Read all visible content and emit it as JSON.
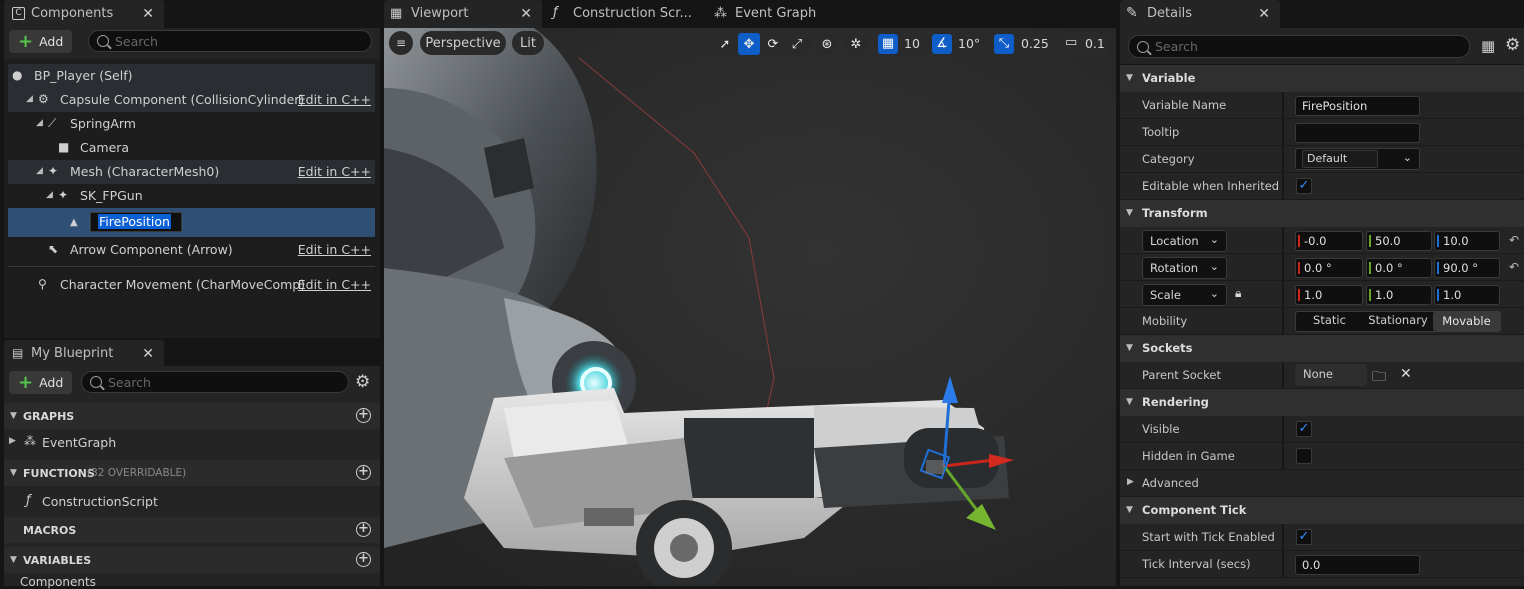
{
  "components_panel": {
    "tab_label": "Components",
    "add_label": "Add",
    "search_placeholder": "Search",
    "tree": [
      {
        "label": "BP_Player (Self)",
        "edit": ""
      },
      {
        "label": "Capsule Component (CollisionCylinder)",
        "edit": "Edit in C++"
      },
      {
        "label": "SpringArm",
        "edit": ""
      },
      {
        "label": "Camera",
        "edit": ""
      },
      {
        "label": "Mesh (CharacterMesh0)",
        "edit": "Edit in C++"
      },
      {
        "label": "SK_FPGun",
        "edit": ""
      },
      {
        "label": "FirePosition",
        "edit": ""
      },
      {
        "label": "Arrow Component (Arrow)",
        "edit": "Edit in C++"
      },
      {
        "label": "Character Movement (CharMoveComp)",
        "edit": "Edit in C++"
      }
    ]
  },
  "my_blueprint": {
    "tab_label": "My Blueprint",
    "add_label": "Add",
    "search_placeholder": "Search",
    "sections": {
      "graphs": "GRAPHS",
      "event_graph": "EventGraph",
      "functions": "FUNCTIONS",
      "functions_note": "(32 OVERRIDABLE)",
      "construction_script": "ConstructionScript",
      "macros": "MACROS",
      "variables": "VARIABLES",
      "components": "Components"
    }
  },
  "viewport": {
    "tabs": [
      "Viewport",
      "Construction Scr...",
      "Event Graph"
    ],
    "perspective": "Perspective",
    "lit": "Lit",
    "grid_snap": "10",
    "rot_snap": "10°",
    "scale_snap": "0.25",
    "camera_speed": "0.1"
  },
  "details": {
    "tab_label": "Details",
    "search_placeholder": "Search",
    "variable_section": "Variable",
    "variable_name_label": "Variable Name",
    "variable_name_value": "FirePosition",
    "tooltip_label": "Tooltip",
    "tooltip_value": "",
    "category_label": "Category",
    "category_value": "Default",
    "editable_label": "Editable when Inherited",
    "transform_section": "Transform",
    "location_label": "Location",
    "location": [
      "-0.0",
      "50.0",
      "10.0"
    ],
    "rotation_label": "Rotation",
    "rotation": [
      "0.0 °",
      "0.0 °",
      "90.0 °"
    ],
    "scale_label": "Scale",
    "scale": [
      "1.0",
      "1.0",
      "1.0"
    ],
    "mobility_label": "Mobility",
    "mobility_options": [
      "Static",
      "Stationary",
      "Movable"
    ],
    "mobility_selected": "Movable",
    "sockets_section": "Sockets",
    "parent_socket_label": "Parent Socket",
    "parent_socket_value": "None",
    "rendering_section": "Rendering",
    "visible_label": "Visible",
    "hidden_label": "Hidden in Game",
    "advanced_label": "Advanced",
    "component_tick_section": "Component Tick",
    "start_tick_label": "Start with Tick Enabled",
    "tick_interval_label": "Tick Interval (secs)",
    "tick_interval_value": "0.0"
  },
  "colors": {
    "selection": "#2f4f75",
    "accent_blue": "#2f8cff",
    "x_axis": "#c8251b",
    "y_axis": "#66a52a",
    "z_axis": "#1e6fd6"
  }
}
